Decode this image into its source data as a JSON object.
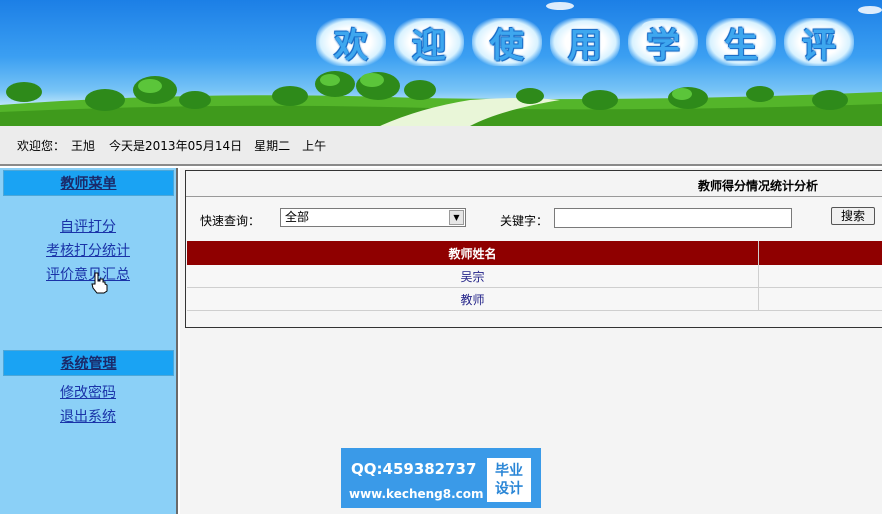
{
  "banner": {
    "title_chars": [
      "欢",
      "迎",
      "使",
      "用",
      "学",
      "生",
      "评"
    ]
  },
  "welcome": {
    "greeting": "欢迎您：",
    "user": "王旭",
    "today": "今天是2013年05月14日",
    "weekday": "星期二",
    "period": "上午"
  },
  "sidebar": {
    "teacher_menu": {
      "title": "教师菜单",
      "items": [
        "自评打分",
        "考核打分统计",
        "评价意见汇总"
      ]
    },
    "system_menu": {
      "title": "系统管理",
      "items": [
        "修改密码",
        "退出系统"
      ]
    }
  },
  "main": {
    "panel_title": "教师得分情况统计分析",
    "quick_query_label": "快速查询：",
    "quick_query_value": "全部",
    "keyword_label": "关键字：",
    "keyword_value": "",
    "search_button": "搜索",
    "table": {
      "headers": [
        "教师姓名",
        ""
      ],
      "rows": [
        [
          "吴宗",
          ""
        ],
        [
          "教师",
          ""
        ]
      ]
    }
  },
  "watermark": {
    "qq": "QQ:459382737",
    "url": "www.kecheng8.com",
    "badge_line1": "毕业",
    "badge_line2": "设计"
  },
  "colors": {
    "banner_sky": "#2a8fee",
    "sidebar_bg": "#8bd0f7",
    "sidebar_header": "#1aa3f3",
    "table_header": "#8f0000",
    "watermark_bg": "#3a9ae8"
  }
}
